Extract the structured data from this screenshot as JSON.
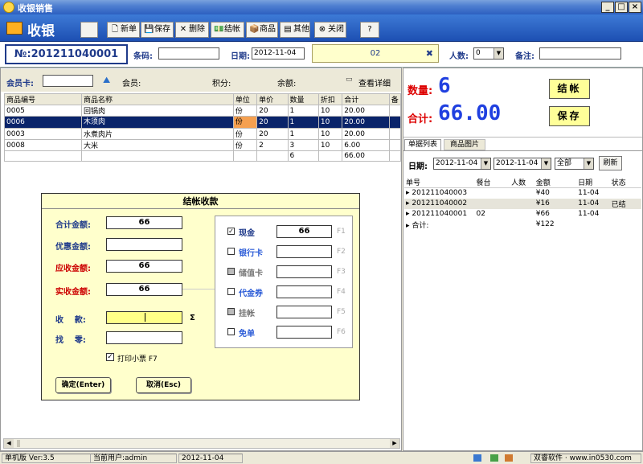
{
  "window": {
    "title": "收银销售"
  },
  "toolbar": {
    "brand": "收银",
    "buttons": [
      {
        "label": "新单",
        "icon": "new-doc-icon",
        "glyph": "🗋"
      },
      {
        "label": "保存",
        "icon": "save-icon",
        "glyph": "💾"
      },
      {
        "label": "删除",
        "icon": "delete-icon",
        "glyph": "✕"
      },
      {
        "label": "结帐",
        "icon": "checkout-icon",
        "glyph": "💵"
      },
      {
        "label": "商品",
        "icon": "goods-icon",
        "glyph": "📦"
      },
      {
        "label": "其他",
        "icon": "other-icon",
        "glyph": "▤"
      },
      {
        "label": "关闭",
        "icon": "close-icon",
        "glyph": "⊗"
      }
    ]
  },
  "info": {
    "order_no": "№:201211040001",
    "barcode_label": "条码:",
    "barcode_value": "",
    "date_label": "日期:",
    "date_value": "2012-11-04",
    "table_no": "02",
    "persons_label": "人数:",
    "persons_value": "0",
    "remark_label": "备注:",
    "remark_value": ""
  },
  "member": {
    "card_label": "会员卡:",
    "card_value": "",
    "member_label": "会员:",
    "points_label": "积分:",
    "balance_label": "余额:",
    "detail_label": "查看详细"
  },
  "items": {
    "headers": [
      "商品编号",
      "商品名称",
      "单位",
      "单价",
      "数量",
      "折扣",
      "合计",
      "备"
    ],
    "rows": [
      [
        "0005",
        "回锅肉",
        "份",
        "20",
        "1",
        "10",
        "20.00"
      ],
      [
        "0006",
        "木须肉",
        "份",
        "20",
        "1",
        "10",
        "20.00"
      ],
      [
        "0003",
        "水煮肉片",
        "份",
        "20",
        "1",
        "10",
        "20.00"
      ],
      [
        "0008",
        "大米",
        "份",
        "2",
        "3",
        "10",
        "6.00"
      ]
    ],
    "total_qty": "6",
    "total_amount": "66.00"
  },
  "dialog": {
    "title": "结帐收款",
    "total_label": "合计金额:",
    "total_value": "66",
    "discount_label": "优惠金额:",
    "discount_value": "",
    "receivable_label": "应收金额:",
    "receivable_value": "66",
    "paid_label": "实收金额:",
    "paid_value": "66",
    "collect_label": "收    款:",
    "collect_value": "",
    "sigma": "Σ",
    "change_label": "找    零:",
    "change_value": "",
    "pay_methods": [
      {
        "label": "现金",
        "value": "66",
        "key": "F1",
        "checked": "☑"
      },
      {
        "label": "银行卡",
        "value": "",
        "key": "F2",
        "checked": "☐"
      },
      {
        "label": "储值卡",
        "value": "",
        "key": "F3",
        "checked": "☐"
      },
      {
        "label": "代金券",
        "value": "",
        "key": "F4",
        "checked": "☐"
      },
      {
        "label": "挂帐",
        "value": "",
        "key": "F5",
        "checked": "☐"
      },
      {
        "label": "免单",
        "value": "",
        "key": "F6",
        "checked": "☐"
      }
    ],
    "print_label": "打印小票 F7",
    "ok_label": "确定(Enter)",
    "cancel_label": "取消(Esc)"
  },
  "summary": {
    "qty_label": "数量:",
    "qty_value": "6",
    "total_label": "合计:",
    "total_value": "66.00",
    "checkout_btn": "结帐",
    "save_btn": "保存"
  },
  "orders": {
    "tabs": [
      "单据列表",
      "商品图片"
    ],
    "date_label": "日期:",
    "date_from": "2012-11-04",
    "date_to": "2012-11-04",
    "filter": "全部",
    "refresh": "刷新",
    "headers": [
      "单号",
      "餐台",
      "人数",
      "金额",
      "日期",
      "状态"
    ],
    "rows": [
      [
        "201211040003",
        "",
        "",
        "¥40",
        "11-04",
        ""
      ],
      [
        "201211040002",
        "",
        "",
        "¥16",
        "11-04",
        "已结"
      ],
      [
        "201211040001",
        "02",
        "",
        "¥66",
        "11-04",
        ""
      ],
      [
        "合计:",
        "",
        "",
        "¥122",
        "",
        ""
      ]
    ]
  },
  "status": {
    "version": "单机版 Ver:3.5",
    "user": "当前用户:admin",
    "date": "2012-11-04",
    "vendor": "双睿软件 · www.in0530.com"
  }
}
